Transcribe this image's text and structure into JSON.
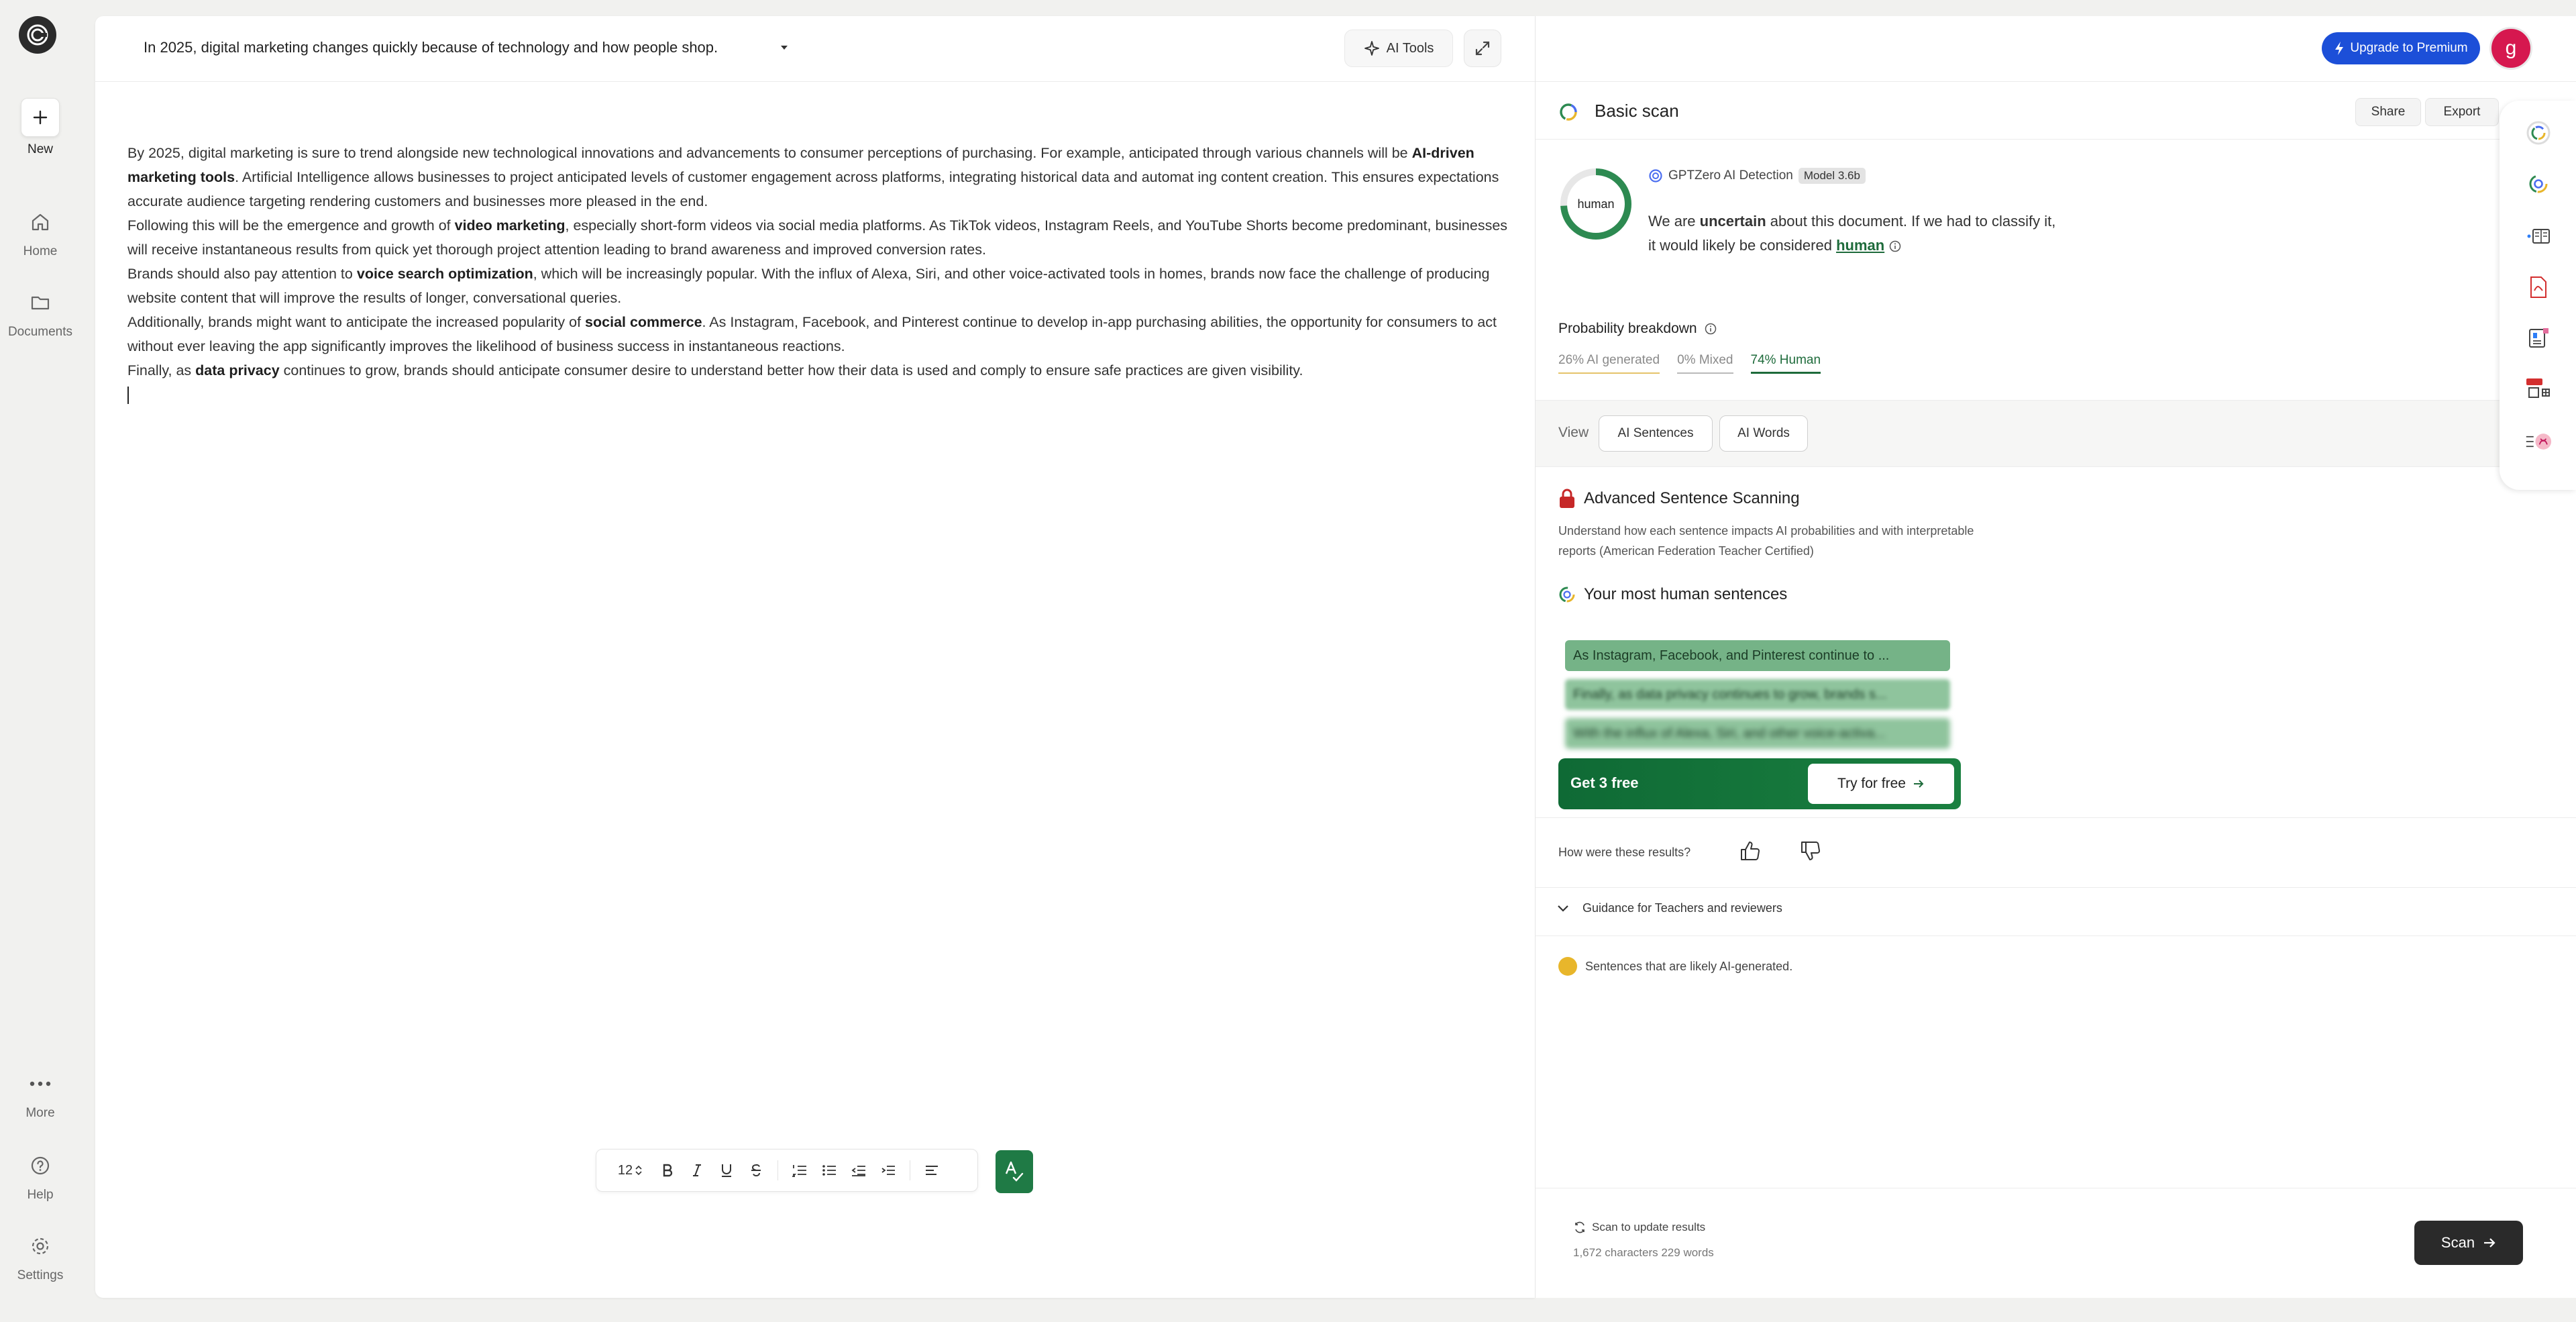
{
  "rail": {
    "new_label": "New",
    "home_label": "Home",
    "documents_label": "Documents",
    "more_label": "More",
    "help_label": "Help",
    "settings_label": "Settings"
  },
  "editor": {
    "title": "In 2025, digital marketing changes quickly because of technology and how people shop.",
    "ai_tools_label": "AI Tools",
    "paragraphs": [
      "By 2025, digital marketing is sure to trend alongside new technological innovations and advancements to consumer perceptions of purchasing. For example, anticipated through various channels will be",
      "AI-driven marketing tools",
      ". Artificial Intelligence allows businesses to project anticipated levels of customer engagement across platforms, integrating historical data and automat ing content creation. This ensures expectations accurate audience targeting rendering customers and businesses more pleased in the end.",
      "Following this will be the emergence and growth of",
      "video marketing",
      ", especially short-form videos via social media platforms. As TikTok videos, Instagram Reels, and YouTube Shorts become predominant, businesses will receive instantaneous results from quick yet thorough project attention leading to brand awareness and improved conversion rates.",
      "Brands should also pay attention to",
      "voice search optimization",
      ", which will be increasingly popular. With the influx of Alexa, Siri, and other voice-activated tools in homes, brands now face the challenge of producing website content that will improve the results of longer, conversational queries.",
      "Additionally, brands might want to anticipate the increased popularity of",
      "social commerce",
      ". As Instagram, Facebook, and Pinterest continue to develop in-app purchasing abilities, the opportunity for consumers to act without ever leaving the app significantly improves the likelihood of business success in instantaneous reactions.",
      "Finally, as",
      "data privacy",
      "continues to grow, brands should anticipate consumer desire to understand better how their data is used and comply to ensure safe practices are given visibility."
    ],
    "font_size": "12"
  },
  "header": {
    "upgrade_label": "Upgrade to Premium",
    "avatar_initial": "g"
  },
  "scan": {
    "title": "Basic scan",
    "share_label": "Share",
    "export_label": "Export",
    "ring_label": "human",
    "detector": "GPTZero AI Detection",
    "model": "Model 3.6b",
    "verdict_a": "We are",
    "verdict_b": "uncertain",
    "verdict_c": "about this document. If we had to classify it, it would likely be considered",
    "verdict_d": "human",
    "human_percent": 74
  },
  "probability": {
    "title": "Probability breakdown",
    "ai": "26% AI generated",
    "mixed": "0% Mixed",
    "human": "74% Human"
  },
  "view": {
    "label": "View",
    "ai_sentences": "AI Sentences",
    "ai_words": "AI Words"
  },
  "advanced": {
    "title": "Advanced Sentence Scanning",
    "desc": "Understand how each sentence impacts AI probabilities and with interpretable reports (American Federation Teacher Certified)",
    "most_human_title": "Your most human sentences",
    "sentences": [
      "As Instagram, Facebook, and Pinterest continue to ...",
      "Finally, as data privacy continues to grow, brands s...",
      "With the influx of Alexa, Siri, and other voice-activa..."
    ],
    "cta_label": "Get 3 free",
    "cta_button": "Try for free"
  },
  "feedback": {
    "question": "How were these results?",
    "guidance": "Guidance for Teachers and reviewers",
    "legend": "Sentences that are likely AI-generated."
  },
  "footer": {
    "update": "Scan to update results",
    "count": "1,672 characters 229 words",
    "scan_label": "Scan"
  },
  "colors": {
    "accent_green": "#1e6b3b",
    "upgrade_blue": "#1c4fd8",
    "ai_yellow": "#e8b62b"
  }
}
